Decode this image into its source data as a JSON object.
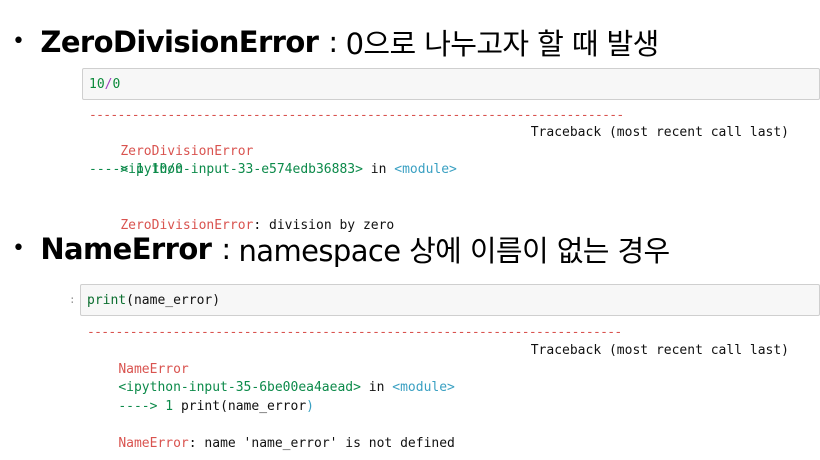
{
  "section1": {
    "bullet": "•",
    "term": "ZeroDivisionError",
    "colon": ":",
    "description": "0으로 나누고자 할 때 발생",
    "input": {
      "num1": "10",
      "op": "/",
      "num2": "0"
    },
    "traceback": {
      "rule": "---------------------------------------------------------------------------",
      "error_name": "ZeroDivisionError",
      "header_right": "Traceback (most recent call last)",
      "source": "<ipython-input-33-e574edb36883>",
      "in": "in",
      "module": "<module>",
      "arrow_line": "----> 1 10/0",
      "final_error": "ZeroDivisionError",
      "final_message": ": division by zero"
    }
  },
  "section2": {
    "bullet": "•",
    "term": "NameError",
    "colon": ":",
    "description": "namespace 상에 이름이 없는 경우",
    "prompt": ":",
    "input": {
      "func": "print",
      "args": "(name_error)"
    },
    "traceback": {
      "rule": "---------------------------------------------------------------------------",
      "error_name": "NameError",
      "header_right": "Traceback (most recent call last)",
      "source": "<ipython-input-35-6be00ea4aead>",
      "in": "in",
      "module": "<module>",
      "arrow_prefix": "----> 1",
      "arrow_code": "print(name_error",
      "arrow_paren": ")",
      "final_error": "NameError",
      "final_message": ": name 'name_error' is not defined"
    }
  }
}
